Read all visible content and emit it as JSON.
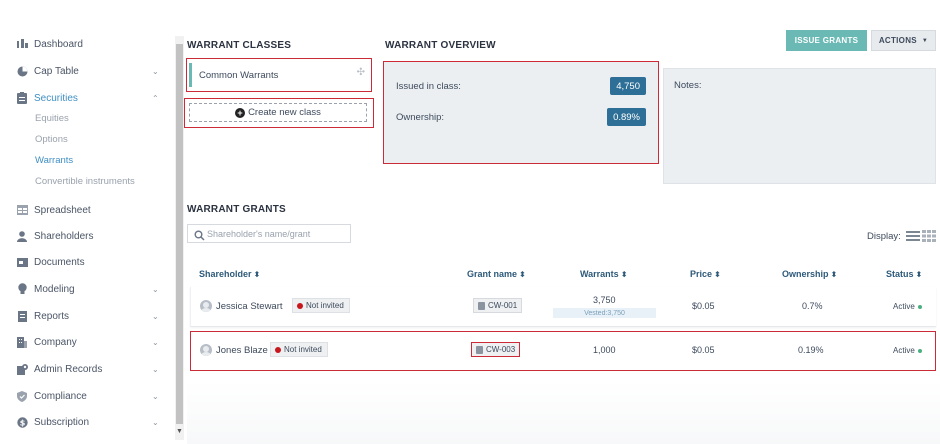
{
  "sidebar": {
    "items": [
      {
        "label": "Dashboard",
        "icon": "chart-bars-icon",
        "chevron": ""
      },
      {
        "label": "Cap Table",
        "icon": "pie-chart-icon",
        "chevron": "⌄"
      },
      {
        "label": "Securities",
        "icon": "clipboard-icon",
        "chevron": "⌃"
      },
      {
        "label": "Spreadsheet",
        "icon": "table-icon",
        "chevron": ""
      },
      {
        "label": "Shareholders",
        "icon": "person-icon",
        "chevron": ""
      },
      {
        "label": "Documents",
        "icon": "folder-icon",
        "chevron": ""
      },
      {
        "label": "Modeling",
        "icon": "lightbulb-icon",
        "chevron": "⌄"
      },
      {
        "label": "Reports",
        "icon": "report-icon",
        "chevron": "⌄"
      },
      {
        "label": "Company",
        "icon": "building-icon",
        "chevron": "⌄"
      },
      {
        "label": "Admin Records",
        "icon": "admin-icon",
        "chevron": "⌄"
      },
      {
        "label": "Compliance",
        "icon": "shield-icon",
        "chevron": "⌄"
      },
      {
        "label": "Subscription",
        "icon": "dollar-icon",
        "chevron": "⌄"
      }
    ],
    "securities_sub": [
      "Equities",
      "Options",
      "Warrants",
      "Convertible instruments"
    ]
  },
  "warrant_classes": {
    "title": "WARRANT CLASSES",
    "items": [
      "Common Warrants"
    ],
    "create_label": "Create new class"
  },
  "overview": {
    "title": "WARRANT OVERVIEW",
    "issued_label": "Issued in class:",
    "issued_value": "4,750",
    "ownership_label": "Ownership:",
    "ownership_value": "0.89%",
    "notes_label": "Notes:"
  },
  "toolbar": {
    "issue_label": "ISSUE GRANTS",
    "actions_label": "ACTIONS",
    "actions_caret": "▼"
  },
  "grants": {
    "title": "WARRANT GRANTS",
    "search_placeholder": "Shareholder's name/grant",
    "display_label": "Display:",
    "columns": [
      "Shareholder",
      "Grant name",
      "Warrants",
      "Price",
      "Ownership",
      "Status"
    ],
    "sort_glyph": "⬍",
    "rows": [
      {
        "name": "Jessica Stewart",
        "invite": "Not invited",
        "grant": "CW-001",
        "warrants": "3,750",
        "vested": "Vested:3,750",
        "price": "$0.05",
        "ownership": "0.7%",
        "status": "Active"
      },
      {
        "name": "Jones Blaze",
        "invite": "Not invited",
        "grant": "CW-003",
        "warrants": "1,000",
        "vested": "",
        "price": "$0.05",
        "ownership": "0.19%",
        "status": "Active"
      }
    ]
  },
  "colors": {
    "accent": "#3f8fc4",
    "teal_button": "#6ab9b4",
    "badge_blue": "#2e6f97",
    "highlight_red": "#cc2a36",
    "status_green": "#4caf80"
  }
}
